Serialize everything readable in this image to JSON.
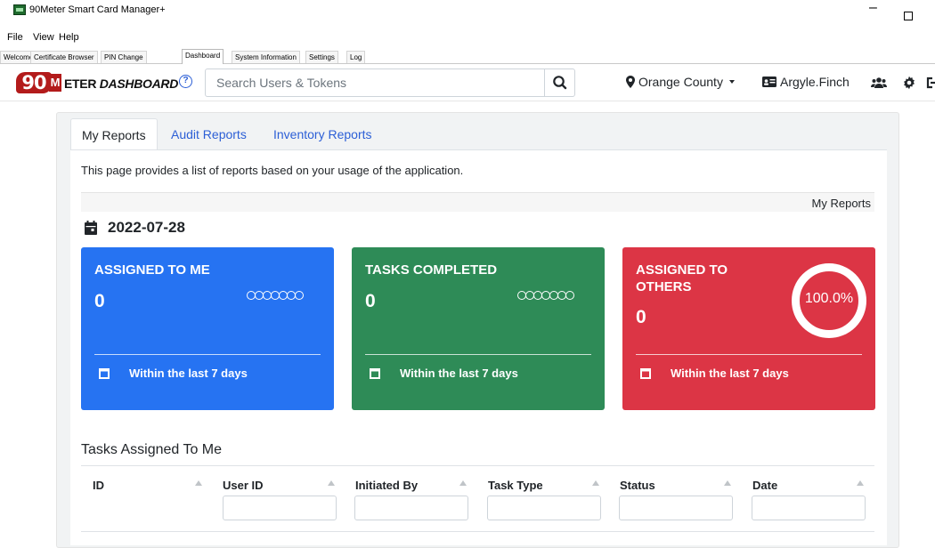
{
  "window": {
    "title": "90Meter Smart Card Manager+",
    "minimize_glyph": "–"
  },
  "menu": [
    "File",
    "View",
    "Help"
  ],
  "window_tabs": [
    {
      "label": "Welcome",
      "active": false
    },
    {
      "label": "Certificate Browser",
      "active": false
    },
    {
      "label": "PIN Change",
      "active": false
    },
    {
      "label": "Dashboard",
      "active": true
    },
    {
      "label": "System Information",
      "active": false
    },
    {
      "label": "Settings",
      "active": false
    },
    {
      "label": "Log",
      "active": false
    }
  ],
  "header": {
    "logo_number": "90",
    "logo_letter": "M",
    "logo_word": "ETER",
    "logo_suffix": "DASHBOARD",
    "help_glyph": "?",
    "search_placeholder": "Search Users & Tokens",
    "location": "Orange County",
    "user": "Argyle.Finch"
  },
  "report_tabs": [
    {
      "label": "My Reports",
      "active": true
    },
    {
      "label": "Audit Reports",
      "active": false
    },
    {
      "label": "Inventory Reports",
      "active": false
    }
  ],
  "intro": "This page provides a list of reports based on your usage of the application.",
  "section_label": "My Reports",
  "date": "2022-07-28",
  "stats": [
    {
      "title": "ASSIGNED TO ME",
      "value": "0",
      "footer": "Within the last 7 days",
      "color": "#2673f2"
    },
    {
      "title": "TASKS COMPLETED",
      "value": "0",
      "footer": "Within the last 7 days",
      "color": "#2e8b57"
    },
    {
      "title": "ASSIGNED TO OTHERS",
      "value": "0",
      "footer": "Within the last 7 days",
      "color": "#dc3545",
      "ring_label": "100.0%"
    }
  ],
  "tasks": {
    "title": "Tasks Assigned To Me",
    "columns": [
      "ID",
      "User ID",
      "Initiated By",
      "Task Type",
      "Status",
      "Date"
    ]
  },
  "colors": {
    "accent": "#2c5fd6",
    "brand": "#b31b1b"
  }
}
